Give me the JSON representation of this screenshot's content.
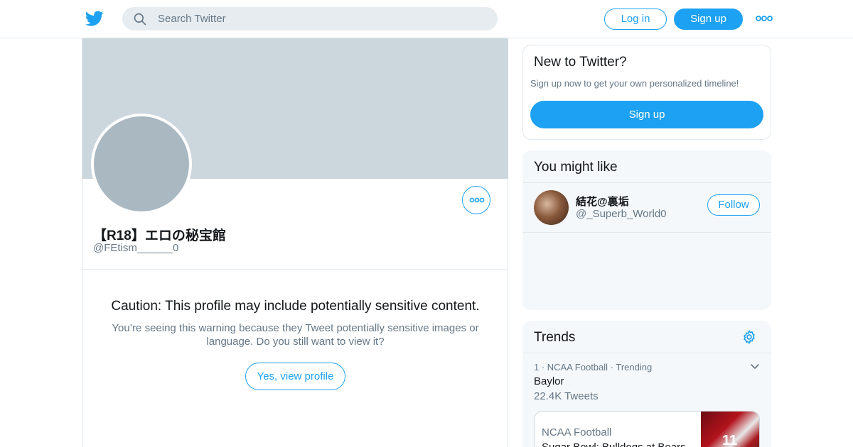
{
  "header": {
    "logo": "twitter-bird-icon",
    "search_placeholder": "Search Twitter",
    "login_label": "Log in",
    "signup_label": "Sign up",
    "more": "more-dots-icon"
  },
  "profile": {
    "display_name": "【R18】エロの秘宝館",
    "handle": "@FEtism______0",
    "caution_title": "Caution: This profile may include potentially sensitive content.",
    "caution_text": "You’re seeing this warning because they Tweet potentially sensitive images or language. Do you still want to view it?",
    "view_label": "Yes, view profile"
  },
  "new_to_twitter": {
    "title": "New to Twitter?",
    "subtitle": "Sign up now to get your own personalized timeline!",
    "signup_label": "Sign up"
  },
  "you_might_like": {
    "title": "You might like",
    "users": [
      {
        "name": "結花@裏垢",
        "handle": "@_Superb_World0",
        "follow_label": "Follow"
      }
    ]
  },
  "trends": {
    "title": "Trends",
    "items": [
      {
        "meta": "1 · NCAA Football · Trending",
        "name": "Baylor",
        "count": "22.4K Tweets"
      }
    ],
    "news": {
      "source": "NCAA Football",
      "title": "Sugar Bowl: Bulldogs at Bears",
      "image_number": "11"
    }
  },
  "colors": {
    "accent": "#1da1f2",
    "banner": "#ccd6dd",
    "avatar_placeholder": "#aab8c2",
    "secondary_text": "#657786"
  }
}
